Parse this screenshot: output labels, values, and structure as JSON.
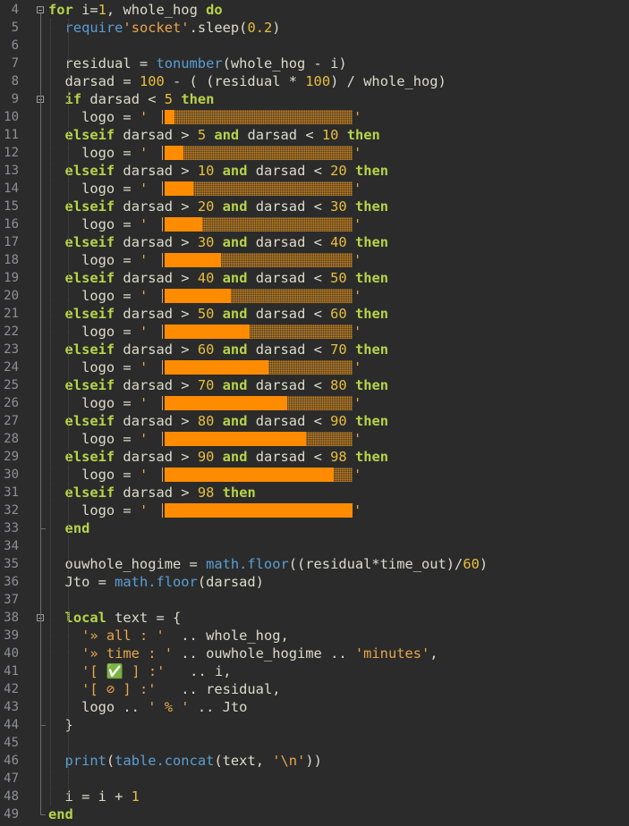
{
  "editor": {
    "language": "lua",
    "theme_colors": {
      "background": "#2b2b2b",
      "keyword": "#b7d448",
      "number": "#e8bf3f",
      "string": "#e8a64a",
      "function": "#5a9fd4",
      "text": "#dcdccc",
      "line_number": "#8f9096",
      "progress_fill": "#ff8c00"
    },
    "lines": [
      {
        "n": "4",
        "tokens": [
          [
            "kw",
            "for"
          ],
          [
            "t",
            " i="
          ],
          [
            "num",
            "1"
          ],
          [
            "t",
            ", whole_hog "
          ],
          [
            "kw",
            "do"
          ]
        ]
      },
      {
        "n": "5",
        "tokens": [
          [
            "t",
            "  "
          ],
          [
            "fn",
            "require"
          ],
          [
            "str",
            "'socket'"
          ],
          [
            "t",
            ".sleep("
          ],
          [
            "num",
            "0.2"
          ],
          [
            "t",
            ")"
          ]
        ]
      },
      {
        "n": "6",
        "tokens": []
      },
      {
        "n": "7",
        "tokens": [
          [
            "t",
            "  residual = "
          ],
          [
            "fn",
            "tonumber"
          ],
          [
            "t",
            "(whole_hog - i)"
          ]
        ]
      },
      {
        "n": "8",
        "tokens": [
          [
            "t",
            "  darsad = "
          ],
          [
            "num",
            "100"
          ],
          [
            "t",
            " - ( (residual * "
          ],
          [
            "num",
            "100"
          ],
          [
            "t",
            ") / whole_hog)"
          ]
        ]
      },
      {
        "n": "9",
        "tokens": [
          [
            "t",
            "  "
          ],
          [
            "kw",
            "if"
          ],
          [
            "t",
            " darsad < "
          ],
          [
            "num",
            "5"
          ],
          [
            "t",
            " "
          ],
          [
            "kw",
            "then"
          ]
        ]
      },
      {
        "n": "10",
        "tokens": [
          [
            "t",
            "    logo = "
          ],
          [
            "str",
            "'"
          ]
        ],
        "bar": 0.05
      },
      {
        "n": "11",
        "tokens": [
          [
            "t",
            "  "
          ],
          [
            "kw",
            "elseif"
          ],
          [
            "t",
            " darsad > "
          ],
          [
            "num",
            "5"
          ],
          [
            "t",
            " "
          ],
          [
            "kw",
            "and"
          ],
          [
            "t",
            " darsad < "
          ],
          [
            "num",
            "10"
          ],
          [
            "t",
            " "
          ],
          [
            "kw",
            "then"
          ]
        ]
      },
      {
        "n": "12",
        "tokens": [
          [
            "t",
            "    logo = "
          ],
          [
            "str",
            "'"
          ]
        ],
        "bar": 0.1
      },
      {
        "n": "13",
        "tokens": [
          [
            "t",
            "  "
          ],
          [
            "kw",
            "elseif"
          ],
          [
            "t",
            " darsad > "
          ],
          [
            "num",
            "10"
          ],
          [
            "t",
            " "
          ],
          [
            "kw",
            "and"
          ],
          [
            "t",
            " darsad < "
          ],
          [
            "num",
            "20"
          ],
          [
            "t",
            " "
          ],
          [
            "kw",
            "then"
          ]
        ]
      },
      {
        "n": "14",
        "tokens": [
          [
            "t",
            "    logo = "
          ],
          [
            "str",
            "'"
          ]
        ],
        "bar": 0.15
      },
      {
        "n": "15",
        "tokens": [
          [
            "t",
            "  "
          ],
          [
            "kw",
            "elseif"
          ],
          [
            "t",
            " darsad > "
          ],
          [
            "num",
            "20"
          ],
          [
            "t",
            " "
          ],
          [
            "kw",
            "and"
          ],
          [
            "t",
            " darsad < "
          ],
          [
            "num",
            "30"
          ],
          [
            "t",
            " "
          ],
          [
            "kw",
            "then"
          ]
        ]
      },
      {
        "n": "16",
        "tokens": [
          [
            "t",
            "    logo = "
          ],
          [
            "str",
            "'"
          ]
        ],
        "bar": 0.2
      },
      {
        "n": "17",
        "tokens": [
          [
            "t",
            "  "
          ],
          [
            "kw",
            "elseif"
          ],
          [
            "t",
            " darsad > "
          ],
          [
            "num",
            "30"
          ],
          [
            "t",
            " "
          ],
          [
            "kw",
            "and"
          ],
          [
            "t",
            " darsad < "
          ],
          [
            "num",
            "40"
          ],
          [
            "t",
            " "
          ],
          [
            "kw",
            "then"
          ]
        ]
      },
      {
        "n": "18",
        "tokens": [
          [
            "t",
            "    logo = "
          ],
          [
            "str",
            "'"
          ]
        ],
        "bar": 0.3
      },
      {
        "n": "19",
        "tokens": [
          [
            "t",
            "  "
          ],
          [
            "kw",
            "elseif"
          ],
          [
            "t",
            " darsad > "
          ],
          [
            "num",
            "40"
          ],
          [
            "t",
            " "
          ],
          [
            "kw",
            "and"
          ],
          [
            "t",
            " darsad < "
          ],
          [
            "num",
            "50"
          ],
          [
            "t",
            " "
          ],
          [
            "kw",
            "then"
          ]
        ]
      },
      {
        "n": "20",
        "tokens": [
          [
            "t",
            "    logo = "
          ],
          [
            "str",
            "'"
          ]
        ],
        "bar": 0.35
      },
      {
        "n": "21",
        "tokens": [
          [
            "t",
            "  "
          ],
          [
            "kw",
            "elseif"
          ],
          [
            "t",
            " darsad > "
          ],
          [
            "num",
            "50"
          ],
          [
            "t",
            " "
          ],
          [
            "kw",
            "and"
          ],
          [
            "t",
            " darsad < "
          ],
          [
            "num",
            "60"
          ],
          [
            "t",
            " "
          ],
          [
            "kw",
            "then"
          ]
        ]
      },
      {
        "n": "22",
        "tokens": [
          [
            "t",
            "    logo = "
          ],
          [
            "str",
            "'"
          ]
        ],
        "bar": 0.45
      },
      {
        "n": "23",
        "tokens": [
          [
            "t",
            "  "
          ],
          [
            "kw",
            "elseif"
          ],
          [
            "t",
            " darsad > "
          ],
          [
            "num",
            "60"
          ],
          [
            "t",
            " "
          ],
          [
            "kw",
            "and"
          ],
          [
            "t",
            " darsad < "
          ],
          [
            "num",
            "70"
          ],
          [
            "t",
            " "
          ],
          [
            "kw",
            "then"
          ]
        ]
      },
      {
        "n": "24",
        "tokens": [
          [
            "t",
            "    logo = "
          ],
          [
            "str",
            "'"
          ]
        ],
        "bar": 0.55
      },
      {
        "n": "25",
        "tokens": [
          [
            "t",
            "  "
          ],
          [
            "kw",
            "elseif"
          ],
          [
            "t",
            " darsad > "
          ],
          [
            "num",
            "70"
          ],
          [
            "t",
            " "
          ],
          [
            "kw",
            "and"
          ],
          [
            "t",
            " darsad < "
          ],
          [
            "num",
            "80"
          ],
          [
            "t",
            " "
          ],
          [
            "kw",
            "then"
          ]
        ]
      },
      {
        "n": "26",
        "tokens": [
          [
            "t",
            "    logo = "
          ],
          [
            "str",
            "'"
          ]
        ],
        "bar": 0.65
      },
      {
        "n": "27",
        "tokens": [
          [
            "t",
            "  "
          ],
          [
            "kw",
            "elseif"
          ],
          [
            "t",
            " darsad > "
          ],
          [
            "num",
            "80"
          ],
          [
            "t",
            " "
          ],
          [
            "kw",
            "and"
          ],
          [
            "t",
            " darsad < "
          ],
          [
            "num",
            "90"
          ],
          [
            "t",
            " "
          ],
          [
            "kw",
            "then"
          ]
        ]
      },
      {
        "n": "28",
        "tokens": [
          [
            "t",
            "    logo = "
          ],
          [
            "str",
            "'"
          ]
        ],
        "bar": 0.75
      },
      {
        "n": "29",
        "tokens": [
          [
            "t",
            "  "
          ],
          [
            "kw",
            "elseif"
          ],
          [
            "t",
            " darsad > "
          ],
          [
            "num",
            "90"
          ],
          [
            "t",
            " "
          ],
          [
            "kw",
            "and"
          ],
          [
            "t",
            " darsad < "
          ],
          [
            "num",
            "98"
          ],
          [
            "t",
            " "
          ],
          [
            "kw",
            "then"
          ]
        ]
      },
      {
        "n": "30",
        "tokens": [
          [
            "t",
            "    logo = "
          ],
          [
            "str",
            "'"
          ]
        ],
        "bar": 0.9
      },
      {
        "n": "31",
        "tokens": [
          [
            "t",
            "  "
          ],
          [
            "kw",
            "elseif"
          ],
          [
            "t",
            " darsad > "
          ],
          [
            "num",
            "98"
          ],
          [
            "t",
            " "
          ],
          [
            "kw",
            "then"
          ]
        ]
      },
      {
        "n": "32",
        "tokens": [
          [
            "t",
            "    logo = "
          ],
          [
            "str",
            "'"
          ]
        ],
        "bar": 1.0
      },
      {
        "n": "33",
        "tokens": [
          [
            "t",
            "  "
          ],
          [
            "kw",
            "end"
          ]
        ]
      },
      {
        "n": "34",
        "tokens": []
      },
      {
        "n": "35",
        "tokens": [
          [
            "t",
            "  ouwhole_hogime = "
          ],
          [
            "fn",
            "math.floor"
          ],
          [
            "t",
            "((residual*time_out)/"
          ],
          [
            "num",
            "60"
          ],
          [
            "t",
            ")"
          ]
        ]
      },
      {
        "n": "36",
        "tokens": [
          [
            "t",
            "  Jto = "
          ],
          [
            "fn",
            "math.floor"
          ],
          [
            "t",
            "(darsad)"
          ]
        ]
      },
      {
        "n": "37",
        "tokens": []
      },
      {
        "n": "38",
        "tokens": [
          [
            "t",
            "  "
          ],
          [
            "kw",
            "local"
          ],
          [
            "t",
            " text = {"
          ]
        ]
      },
      {
        "n": "39",
        "tokens": [
          [
            "t",
            "    "
          ],
          [
            "str",
            "'» all : '"
          ],
          [
            "t",
            "  .. whole_hog,"
          ]
        ]
      },
      {
        "n": "40",
        "tokens": [
          [
            "t",
            "    "
          ],
          [
            "str",
            "'» time : '"
          ],
          [
            "t",
            " .. ouwhole_hogime .. "
          ],
          [
            "str",
            "'minutes'"
          ],
          [
            "t",
            ","
          ]
        ]
      },
      {
        "n": "41",
        "tokens": [
          [
            "t",
            "    "
          ],
          [
            "str",
            "'[ ✅ ] :'"
          ],
          [
            "t",
            "   .. i,"
          ]
        ]
      },
      {
        "n": "42",
        "tokens": [
          [
            "t",
            "    "
          ],
          [
            "str",
            "'[ ⊘ ] :'"
          ],
          [
            "t",
            "   .. residual,"
          ]
        ]
      },
      {
        "n": "43",
        "tokens": [
          [
            "t",
            "    logo .. "
          ],
          [
            "str",
            "' % '"
          ],
          [
            "t",
            " .. Jto"
          ]
        ]
      },
      {
        "n": "44",
        "tokens": [
          [
            "t",
            "  }"
          ]
        ]
      },
      {
        "n": "45",
        "tokens": []
      },
      {
        "n": "46",
        "tokens": [
          [
            "t",
            "  "
          ],
          [
            "fn",
            "print"
          ],
          [
            "t",
            "("
          ],
          [
            "fn",
            "table.concat"
          ],
          [
            "t",
            "(text, "
          ],
          [
            "str",
            "'\\n'"
          ],
          [
            "t",
            "))"
          ]
        ]
      },
      {
        "n": "47",
        "tokens": []
      },
      {
        "n": "48",
        "tokens": [
          [
            "t",
            "  i = i + "
          ],
          [
            "num",
            "1"
          ]
        ]
      },
      {
        "n": "49",
        "tokens": [
          [
            "kw",
            "end"
          ]
        ]
      }
    ]
  }
}
